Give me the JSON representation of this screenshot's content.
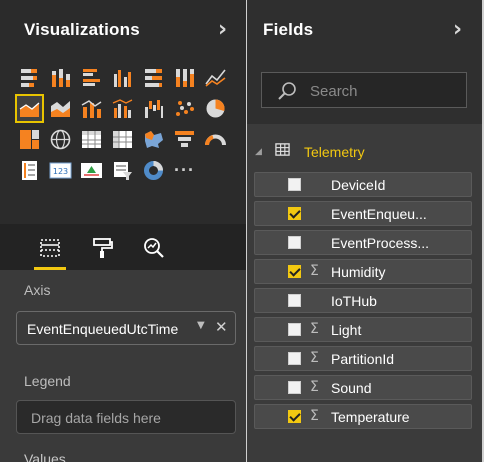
{
  "visualizations": {
    "title": "Visualizations",
    "expand_icon": "chevron-right-icon",
    "icons": [
      {
        "name": "stacked-bar-icon"
      },
      {
        "name": "stacked-column-icon"
      },
      {
        "name": "clustered-bar-icon"
      },
      {
        "name": "clustered-column-icon"
      },
      {
        "name": "100-stacked-bar-icon"
      },
      {
        "name": "100-stacked-column-icon"
      },
      {
        "name": "line-chart-icon"
      },
      {
        "name": "area-chart-icon",
        "selected": true
      },
      {
        "name": "stacked-area-icon"
      },
      {
        "name": "line-and-stacked-column-icon"
      },
      {
        "name": "line-and-clustered-column-icon"
      },
      {
        "name": "waterfall-icon"
      },
      {
        "name": "scatter-chart-icon"
      },
      {
        "name": "pie-chart-icon"
      },
      {
        "name": "treemap-icon"
      },
      {
        "name": "map-icon"
      },
      {
        "name": "table-icon"
      },
      {
        "name": "matrix-icon"
      },
      {
        "name": "filled-map-icon"
      },
      {
        "name": "funnel-icon"
      },
      {
        "name": "gauge-icon"
      },
      {
        "name": "multi-row-card-icon"
      },
      {
        "name": "card-icon"
      },
      {
        "name": "kpi-icon"
      },
      {
        "name": "slicer-icon"
      },
      {
        "name": "donut-chart-icon"
      },
      {
        "name": "more-visuals-icon"
      }
    ],
    "tabs": [
      {
        "name": "fields-tab-icon",
        "active": true
      },
      {
        "name": "format-paint-roller-icon"
      },
      {
        "name": "analytics-magnifier-icon"
      }
    ],
    "axis": {
      "label": "Axis",
      "value": "EventEnqueuedUtcTime"
    },
    "legend": {
      "label": "Legend",
      "placeholder": "Drag data fields here"
    },
    "values": {
      "label": "Values"
    }
  },
  "fields": {
    "title": "Fields",
    "search_placeholder": "Search",
    "table": {
      "name": "Telemetry"
    },
    "items": [
      {
        "label": "DeviceId",
        "checked": false,
        "sigma": false
      },
      {
        "label": "EventEnqueu...",
        "checked": true,
        "sigma": false
      },
      {
        "label": "EventProcess...",
        "checked": false,
        "sigma": false
      },
      {
        "label": "Humidity",
        "checked": true,
        "sigma": true
      },
      {
        "label": "IoTHub",
        "checked": false,
        "sigma": false
      },
      {
        "label": "Light",
        "checked": false,
        "sigma": true
      },
      {
        "label": "PartitionId",
        "checked": false,
        "sigma": true
      },
      {
        "label": "Sound",
        "checked": false,
        "sigma": true
      },
      {
        "label": "Temperature",
        "checked": true,
        "sigma": true
      }
    ]
  },
  "colors": {
    "accent": "#f2c811",
    "pane": "#2b2b2b",
    "field_row": "#4a4a4a"
  }
}
